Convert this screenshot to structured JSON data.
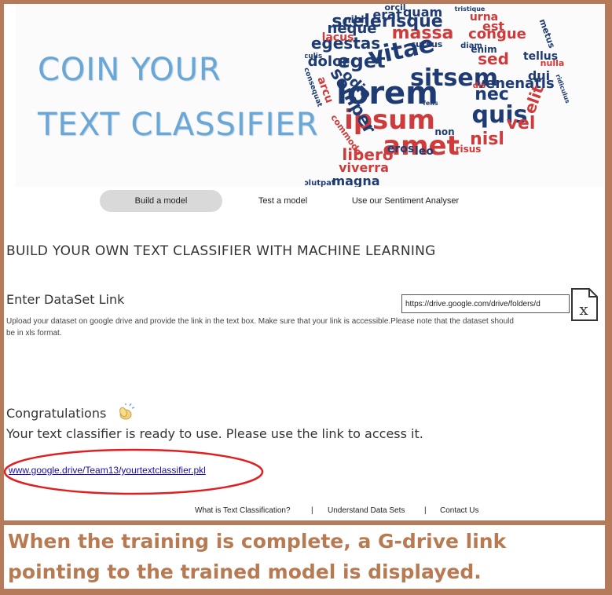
{
  "header": {
    "title_line1": "COIN YOUR",
    "title_line2": "TEXT CLASSIFIER",
    "wordcloud_words": [
      {
        "text": "lorem",
        "color": "#1f3b73"
      },
      {
        "text": "ipsum",
        "color": "#cf3a3a"
      },
      {
        "text": "amet",
        "color": "#cf3a3a"
      },
      {
        "text": "sitsem",
        "color": "#1f3b73"
      },
      {
        "text": "vitae",
        "color": "#1f3b73"
      },
      {
        "text": "eget",
        "color": "#1f3b73"
      },
      {
        "text": "massa",
        "color": "#cf3a3a"
      },
      {
        "text": "scelerisque",
        "color": "#1f3b73"
      },
      {
        "text": "egestas",
        "color": "#1f3b73"
      },
      {
        "text": "neque",
        "color": "#1f3b73"
      },
      {
        "text": "congue",
        "color": "#cf3a3a"
      },
      {
        "text": "sed",
        "color": "#cf3a3a"
      },
      {
        "text": "quis",
        "color": "#1f3b73"
      },
      {
        "text": "nec",
        "color": "#1f3b73"
      },
      {
        "text": "venenatis",
        "color": "#1f3b73"
      },
      {
        "text": "semper",
        "color": "#1f3b73"
      },
      {
        "text": "dolor",
        "color": "#1f3b73"
      },
      {
        "text": "odio",
        "color": "#1f3b73"
      },
      {
        "text": "nisl",
        "color": "#cf3a3a"
      },
      {
        "text": "libero",
        "color": "#cf3a3a"
      },
      {
        "text": "viverra",
        "color": "#cf3a3a"
      },
      {
        "text": "magna",
        "color": "#1f3b73"
      },
      {
        "text": "eros",
        "color": "#1f3b73"
      },
      {
        "text": "leo",
        "color": "#1f3b73"
      },
      {
        "text": "quam",
        "color": "#1f3b73"
      },
      {
        "text": "erat",
        "color": "#1f3b73"
      },
      {
        "text": "orcil",
        "color": "#1f3b73"
      },
      {
        "text": "urna",
        "color": "#cf3a3a"
      },
      {
        "text": "est",
        "color": "#cf3a3a"
      },
      {
        "text": "lacus",
        "color": "#cf3a3a"
      },
      {
        "text": "nibh",
        "color": "#1f3b73"
      },
      {
        "text": "tellus",
        "color": "#1f3b73"
      },
      {
        "text": "dui",
        "color": "#1f3b73"
      },
      {
        "text": "vel",
        "color": "#cf3a3a"
      },
      {
        "text": "elit",
        "color": "#cf3a3a"
      },
      {
        "text": "arcu",
        "color": "#cf3a3a"
      },
      {
        "text": "non",
        "color": "#1f3b73"
      },
      {
        "text": "risus",
        "color": "#cf3a3a"
      },
      {
        "text": "enim",
        "color": "#1f3b73"
      },
      {
        "text": "cursus",
        "color": "#1f3b73"
      },
      {
        "text": "commodo",
        "color": "#cf3a3a"
      },
      {
        "text": "metus",
        "color": "#1f3b73"
      },
      {
        "text": "nulla",
        "color": "#cf3a3a"
      },
      {
        "text": "iaculis",
        "color": "#1f3b73"
      },
      {
        "text": "volutpat",
        "color": "#1f3b73"
      },
      {
        "text": "consequat",
        "color": "#1f3b73"
      },
      {
        "text": "diam",
        "color": "#1f3b73"
      },
      {
        "text": "dis",
        "color": "#cf3a3a"
      },
      {
        "text": "felis",
        "color": "#1f3b73"
      },
      {
        "text": "tristique",
        "color": "#1f3b73"
      },
      {
        "text": "ridiculus",
        "color": "#1f3b73"
      }
    ]
  },
  "nav": {
    "build": "Build a  model",
    "test": "Test a model",
    "sentiment": "Use our Sentiment Analyser"
  },
  "main": {
    "heading": "BUILD YOUR OWN TEXT CLASSIFIER WITH MACHINE LEARNING",
    "dataset_label": "Enter DataSet Link",
    "dataset_value": "https://drive.google.com/drive/folders/d",
    "help_text": "Upload your dataset on google drive and provide the link in the text box.  Make sure that your link is accessible.Please note that the dataset should be in xls format.",
    "file_icon": "excel-file-icon",
    "file_icon_letter": "x",
    "congrats": "Congratulations",
    "clap_icon": "clapping-hands-icon",
    "ready_text": "Your text classifier is ready to use. Please use the link to access it.",
    "model_link": "www.google.drive/Team13/yourtextclassifier.pkl"
  },
  "footer": {
    "links": [
      "What is Text Classification?",
      "Understand Data Sets",
      "Contact Us"
    ],
    "separator": "|"
  },
  "caption": "When the training is complete, a G-drive link pointing to the trained model is displayed.",
  "colors": {
    "border": "#b47a5a",
    "caption": "#b87a52",
    "title": "#6aa7d6",
    "word_blue": "#1f3b73",
    "word_red": "#cf3a3a",
    "highlight_ellipse": "#e02020",
    "link": "#1a0dab"
  }
}
